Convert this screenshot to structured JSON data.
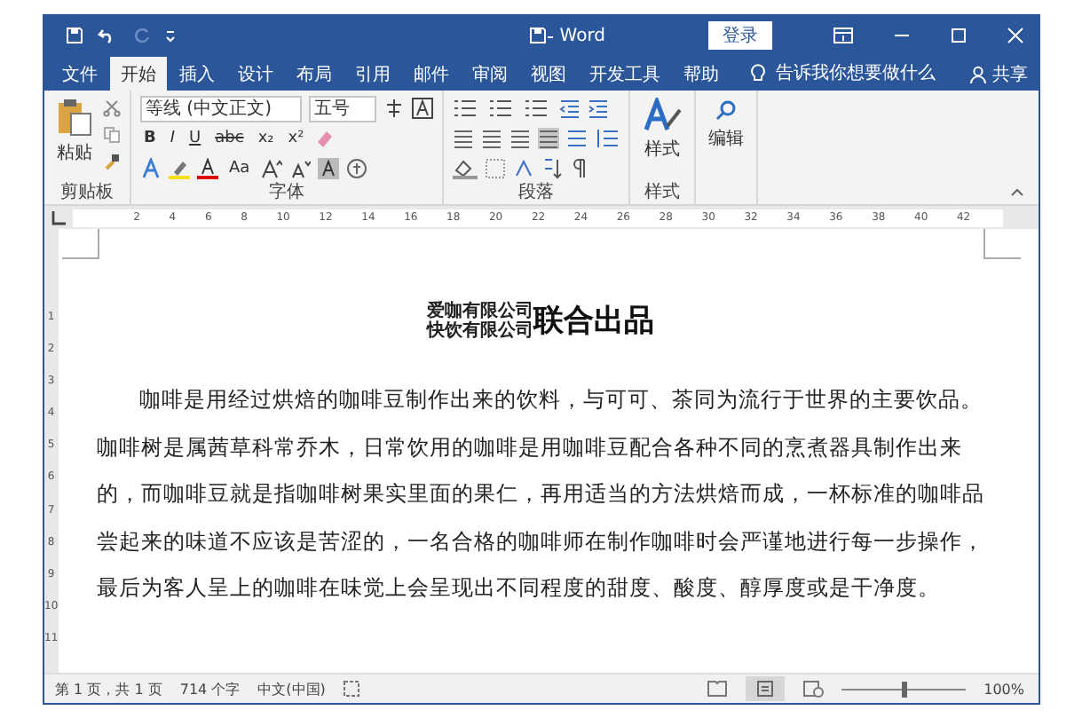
{
  "title_bar": {
    "title": "Word",
    "login": "登录"
  },
  "tabs": [
    {
      "label": "文件",
      "selected": false
    },
    {
      "label": "开始",
      "selected": true
    },
    {
      "label": "插入",
      "selected": false
    },
    {
      "label": "设计",
      "selected": false
    },
    {
      "label": "布局",
      "selected": false
    },
    {
      "label": "引用",
      "selected": false
    },
    {
      "label": "邮件",
      "selected": false
    },
    {
      "label": "审阅",
      "selected": false
    },
    {
      "label": "视图",
      "selected": false
    },
    {
      "label": "开发工具",
      "selected": false
    },
    {
      "label": "帮助",
      "selected": false
    }
  ],
  "tell_me": {
    "placeholder": "告诉我你想要做什么"
  },
  "share": "共享",
  "ribbon": {
    "clipboard": {
      "paste": "粘贴",
      "label": "剪贴板"
    },
    "font": {
      "name": "等线 (中文正文)",
      "size": "五号",
      "format_buttons": [
        "B",
        "I",
        "U",
        "abc",
        "x₂",
        "x²"
      ],
      "case_button": "Aa",
      "label": "字体"
    },
    "paragraph": {
      "label": "段落"
    },
    "styles": {
      "button": "样式",
      "label": "样式"
    },
    "editing": {
      "button": "编辑"
    }
  },
  "ruler": {
    "numbers": [
      "2",
      "4",
      "6",
      "8",
      "10",
      "12",
      "14",
      "16",
      "18",
      "20",
      "22",
      "24",
      "26",
      "28",
      "30",
      "32",
      "34",
      "36",
      "38",
      "40",
      "42"
    ]
  },
  "vertical_ruler": {
    "numbers": [
      "1",
      "2",
      "3",
      "4",
      "5",
      "6",
      "7",
      "8",
      "9",
      "10",
      "11"
    ]
  },
  "document": {
    "title": {
      "stacked": [
        "爱咖有限公司",
        "快饮有限公司"
      ],
      "main": "联合出品"
    },
    "lines": [
      "咖啡是用经过烘焙的咖啡豆制作出来的饮料，与可可、茶同为流行于世界的主要饮品。",
      "咖啡树是属茜草科常乔木，日常饮用的咖啡是用咖啡豆配合各种不同的烹煮器具制作出来",
      "的，而咖啡豆就是指咖啡树果实里面的果仁，再用适当的方法烘焙而成，一杯标准的咖啡品",
      "尝起来的味道不应该是苦涩的，一名合格的咖啡师在制作咖啡时会严谨地进行每一步操作，",
      "最后为客人呈上的咖啡在味觉上会呈现出不同程度的甜度、酸度、醇厚度或是干净度。"
    ]
  },
  "status_bar": {
    "page": "第 1 页，共 1 页",
    "words": "714 个字",
    "language": "中文(中国)",
    "zoom": "100%",
    "zoom_slider": {
      "level": 0.5
    }
  }
}
